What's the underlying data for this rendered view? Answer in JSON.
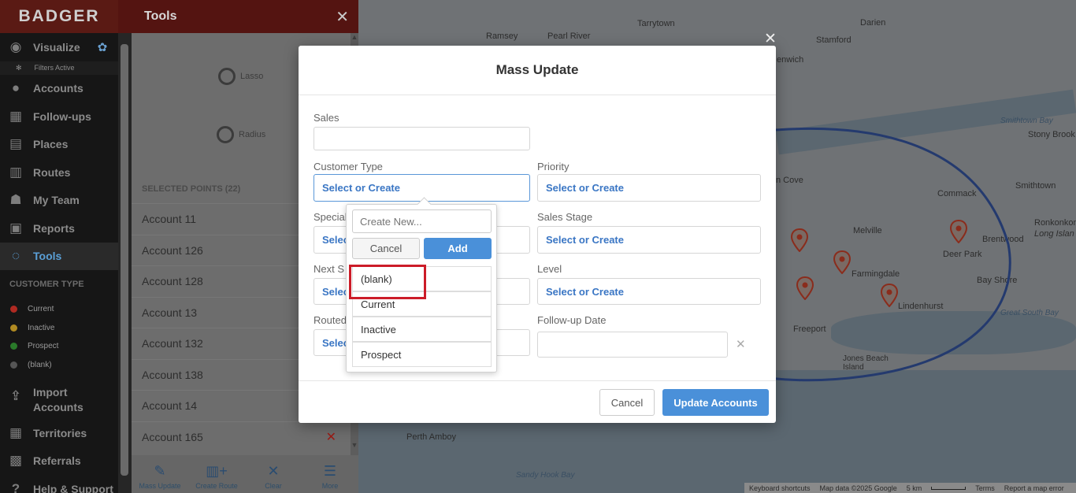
{
  "nav": {
    "logo": "BADGER",
    "items": [
      {
        "label": "Visualize",
        "icon": "eye-icon",
        "glyph": "◉"
      },
      {
        "label": "Accounts",
        "icon": "person-icon",
        "glyph": "●"
      },
      {
        "label": "Follow-ups",
        "icon": "calendar-icon",
        "glyph": "▦"
      },
      {
        "label": "Places",
        "icon": "store-icon",
        "glyph": "▤"
      },
      {
        "label": "Routes",
        "icon": "map-icon",
        "glyph": "▥"
      },
      {
        "label": "My Team",
        "icon": "team-icon",
        "glyph": "☗"
      },
      {
        "label": "Reports",
        "icon": "report-icon",
        "glyph": "▣"
      },
      {
        "label": "Tools",
        "icon": "lasso-icon",
        "glyph": "◌"
      }
    ],
    "filters_active": "Filters Active",
    "customer_type_heading": "CUSTOMER TYPE",
    "legend": [
      {
        "label": "Current",
        "color": "#b02a22"
      },
      {
        "label": "Inactive",
        "color": "#b08a22"
      },
      {
        "label": "Prospect",
        "color": "#2a7a2a"
      },
      {
        "label": "(blank)",
        "color": "#555555"
      }
    ],
    "import_accounts": "Import Accounts",
    "territories": "Territories",
    "referrals": "Referrals",
    "help": "Help & Support"
  },
  "tools": {
    "title": "Tools",
    "lasso": "Lasso",
    "radius": "Radius",
    "selected_points": "SELECTED POINTS (22)",
    "accounts": [
      "Account 11",
      "Account 126",
      "Account 128",
      "Account 13",
      "Account 132",
      "Account 138",
      "Account 14",
      "Account 165"
    ],
    "bottom": {
      "mass_update": "Mass Update",
      "create_route": "Create Route",
      "clear": "Clear",
      "more": "More"
    }
  },
  "map": {
    "labels": {
      "tarrytown": "Tarrytown",
      "ramsey": "Ramsey",
      "pearl_river": "Pearl River",
      "stamford": "Stamford",
      "darien": "Darien",
      "greenwich": "enwich",
      "stony_brook": "Stony Brook",
      "smithtown_bay": "Smithtown Bay",
      "smithtown": "Smithtown",
      "commack": "Commack",
      "cove": "n Cove",
      "ronkonkoma": "Ronkonkoma",
      "long_island": "Long Islan",
      "melville": "Melville",
      "brentwood": "Brentwood",
      "deer_park": "Deer Park",
      "farmingdale": "Farmingdale",
      "bay_shore": "Bay Shore",
      "lindenhurst": "Lindenhurst",
      "great_south_bay": "Great South Bay",
      "freeport": "Freeport",
      "jones_beach": "Jones Beach Island",
      "perth_amboy": "Perth Amboy",
      "sandy_hook": "Sandy Hook Bay"
    },
    "footer": {
      "shortcuts": "Keyboard shortcuts",
      "map_data": "Map data ©2025 Google",
      "scale": "5 km",
      "terms": "Terms",
      "report": "Report a map error"
    }
  },
  "modal": {
    "title": "Mass Update",
    "fields": {
      "sales_label": "Sales",
      "sales_value": "",
      "customer_type_label": "Customer Type",
      "customer_type_value": "Select or Create",
      "priority_label": "Priority",
      "priority_value": "Select or Create",
      "specialty_label": "Special",
      "specialty_value": "Selec",
      "sales_stage_label": "Sales Stage",
      "sales_stage_value": "Select or Create",
      "next_step_label": "Next S",
      "next_step_value": "Selec",
      "level_label": "Level",
      "level_value": "Select or Create",
      "routed_label": "Routed",
      "routed_value": "Selec",
      "followup_label": "Follow-up Date",
      "followup_value": ""
    },
    "cancel": "Cancel",
    "update": "Update Accounts"
  },
  "dropdown": {
    "create_placeholder": "Create New...",
    "cancel": "Cancel",
    "add": "Add",
    "options": [
      "(blank)",
      "Current",
      "Inactive",
      "Prospect"
    ]
  }
}
